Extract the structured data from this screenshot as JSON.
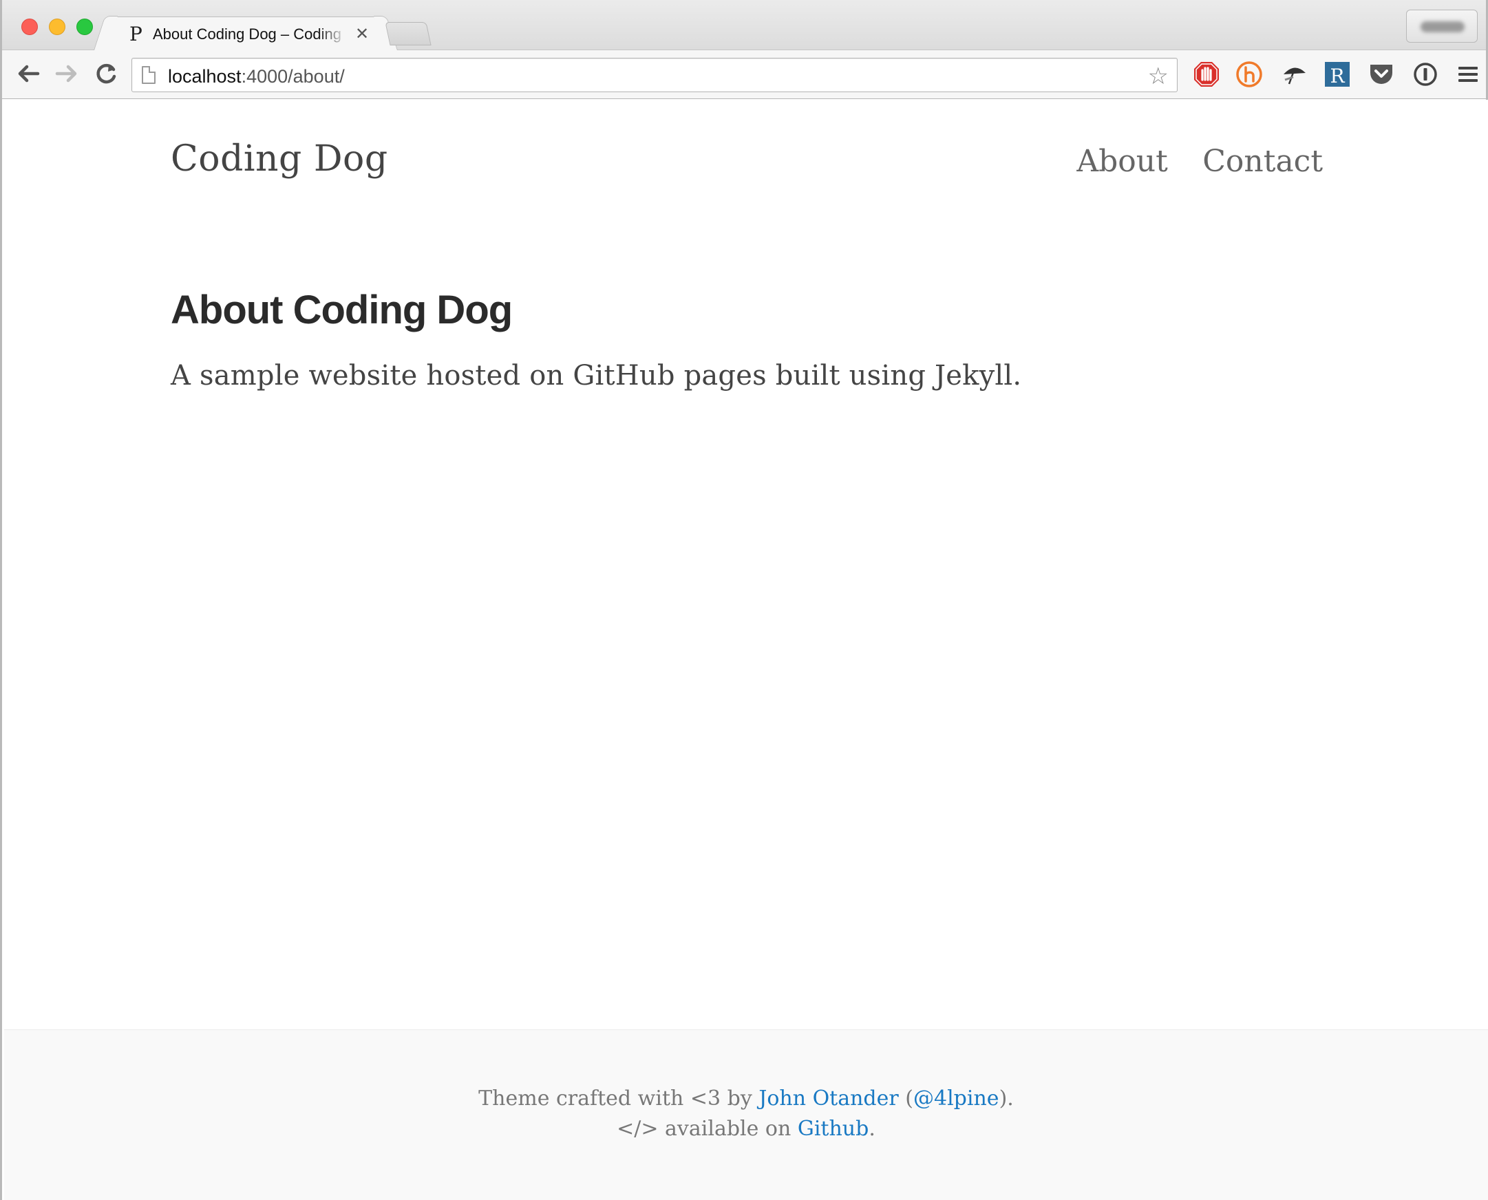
{
  "browser": {
    "tab": {
      "favicon": "P",
      "title": "About Coding Dog – Coding Dog",
      "close": "✕"
    },
    "nav": {
      "back": "🡐",
      "forward": "🡒",
      "reload": "↻"
    },
    "address": {
      "host": "localhost",
      "rest": ":4000/about/"
    },
    "extensions": [
      "adblock-icon",
      "hb-icon",
      "umbrella-icon",
      "r-icon",
      "pocket-icon",
      "info-icon",
      "menu-icon"
    ]
  },
  "site": {
    "title": "Coding Dog",
    "nav": [
      {
        "label": "About"
      },
      {
        "label": "Contact"
      }
    ]
  },
  "post": {
    "title": "About Coding Dog",
    "body": "A sample website hosted on GitHub pages built using Jekyll."
  },
  "footer": {
    "line1_prefix": "Theme crafted with <3 by ",
    "author": "John Otander",
    "paren_open": " (",
    "handle": "@4lpine",
    "paren_close": ").",
    "line2_prefix": "</> available on ",
    "github": "Github",
    "line2_suffix": "."
  },
  "colors": {
    "link": "#1979c3",
    "text": "#444444",
    "heading": "#2b2b2b",
    "footer_bg": "#f9f9f9"
  }
}
